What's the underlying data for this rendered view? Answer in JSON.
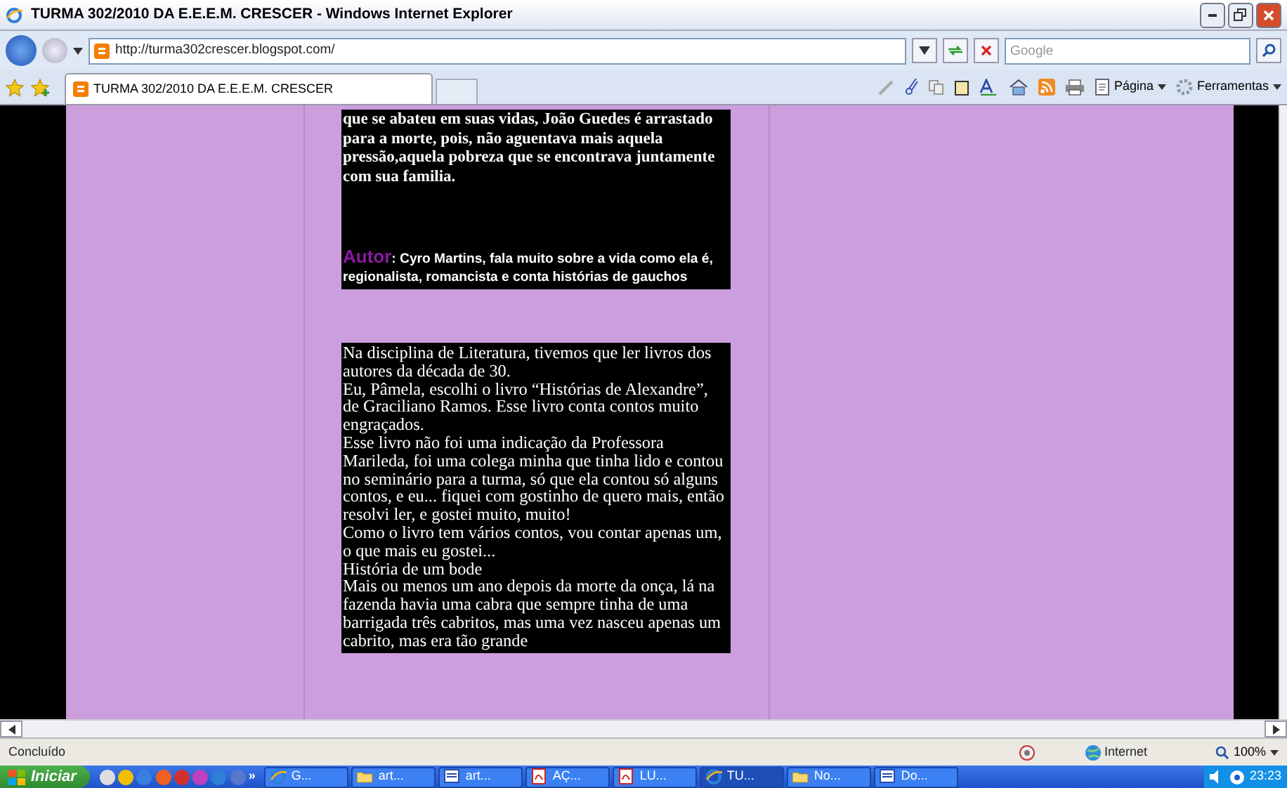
{
  "window": {
    "title": "TURMA 302/2010 DA E.E.E.M. CRESCER - Windows Internet Explorer"
  },
  "address_bar": {
    "url": "http://turma302crescer.blogspot.com/"
  },
  "search": {
    "placeholder": "Google"
  },
  "tabs": [
    {
      "label": "TURMA 302/2010 DA E.E.E.M. CRESCER",
      "selected": true
    }
  ],
  "command_bar": [
    "Página",
    "Ferramentas"
  ],
  "posts": [
    {
      "paragraphs": [
        "que se abateu em suas vidas, João Guedes é arrastado para a morte, pois, não aguentava mais aquela pressão,aquela pobreza que se encontrava juntamente com sua familia."
      ],
      "author": {
        "label": "Autor",
        "text": ": Cyro Martins, fala muito sobre a vida como ela é, regionalista, romancista e conta histórias de gauchos"
      }
    },
    {
      "paragraphs": [
        "Na disciplina de Literatura, tivemos que ler livros dos autores da década de 30.",
        "Eu, Pâmela, escolhi o livro “Histórias de Alexandre”, de Graciliano Ramos. Esse livro conta contos muito engraçados.",
        "Esse livro não foi uma indicação da Professora Marileda, foi uma colega minha que tinha lido e contou no seminário para a turma, só que ela contou só alguns contos, e eu... fiquei com gostinho de quero mais, então resolvi ler, e gostei muito, muito!",
        "Como o livro tem vários contos, vou contar apenas um, o que mais eu gostei...",
        "História de um bode",
        "Mais ou menos um ano depois da morte da onça, lá na fazenda havia uma cabra que sempre tinha de uma barrigada três cabritos, mas uma vez nasceu apenas um cabrito, mas era tão grande"
      ]
    }
  ],
  "status_bar": {
    "text": "Concluído",
    "zone": "Internet",
    "zoom": "100%"
  },
  "taskbar": {
    "start": "Iniciar",
    "more": "»",
    "tasks": [
      {
        "label": "G...",
        "kind": "ie",
        "selected": false
      },
      {
        "label": "art...",
        "kind": "folder",
        "selected": false
      },
      {
        "label": "art...",
        "kind": "doc",
        "selected": false
      },
      {
        "label": "AÇ...",
        "kind": "pdf",
        "selected": false
      },
      {
        "label": "LU...",
        "kind": "pdf",
        "selected": false
      },
      {
        "label": "TU...",
        "kind": "ie",
        "selected": true
      },
      {
        "label": "No...",
        "kind": "folder",
        "selected": false
      },
      {
        "label": "Do...",
        "kind": "doc",
        "selected": false
      }
    ],
    "clock": "23:23"
  }
}
